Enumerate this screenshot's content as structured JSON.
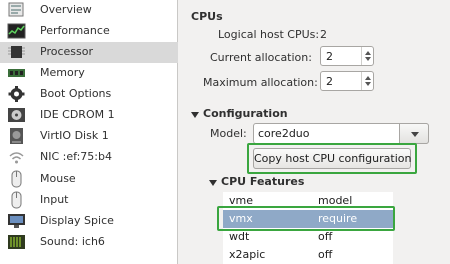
{
  "sidebar": {
    "items": [
      {
        "label": "Overview",
        "icon": "overview-icon"
      },
      {
        "label": "Performance",
        "icon": "performance-icon"
      },
      {
        "label": "Processor",
        "icon": "processor-icon"
      },
      {
        "label": "Memory",
        "icon": "memory-icon"
      },
      {
        "label": "Boot Options",
        "icon": "gear-icon"
      },
      {
        "label": "IDE CDROM 1",
        "icon": "cdrom-icon"
      },
      {
        "label": "VirtIO Disk 1",
        "icon": "disk-icon"
      },
      {
        "label": "NIC :ef:75:b4",
        "icon": "network-icon"
      },
      {
        "label": "Mouse",
        "icon": "mouse-icon"
      },
      {
        "label": "Input",
        "icon": "input-icon"
      },
      {
        "label": "Display Spice",
        "icon": "display-icon"
      },
      {
        "label": "Sound: ich6",
        "icon": "sound-icon"
      }
    ],
    "selected_index": 2
  },
  "cpus": {
    "title": "CPUs",
    "logical_label": "Logical host CPUs:",
    "logical_value": "2",
    "current_label": "Current allocation:",
    "current_value": "2",
    "maximum_label": "Maximum allocation:",
    "maximum_value": "2"
  },
  "configuration": {
    "title": "Configuration",
    "model_label": "Model:",
    "model_value": "core2duo",
    "copy_button": "Copy host CPU configuration"
  },
  "features": {
    "title": "CPU Features",
    "rows": [
      {
        "name": "vme",
        "policy": "model"
      },
      {
        "name": "vmx",
        "policy": "require"
      },
      {
        "name": "wdt",
        "policy": "off"
      },
      {
        "name": "x2apic",
        "policy": "off"
      }
    ],
    "selected_index": 1
  },
  "colors": {
    "highlight_green": "#3aa63f",
    "row_selected": "#8fa9c7",
    "sidebar_selected": "#d9d9d9"
  }
}
